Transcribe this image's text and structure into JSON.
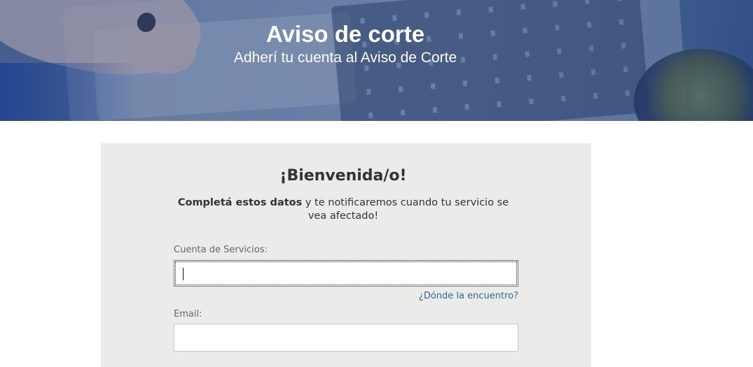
{
  "hero": {
    "title": "Aviso de corte",
    "subtitle": "Adherí tu cuenta al Aviso de Corte"
  },
  "card": {
    "welcome": "¡Bienvenida/o!",
    "intro_bold": "Completá estos datos",
    "intro_rest": " y te notificaremos cuando tu servicio se vea afectado!"
  },
  "form": {
    "account_label": "Cuenta de Servicios:",
    "account_value": "",
    "help_link": "¿Dónde la encuentro?",
    "email_label": "Email:",
    "email_value": ""
  },
  "colors": {
    "card_background": "#ebebe9",
    "link": "#2a6c9e"
  }
}
